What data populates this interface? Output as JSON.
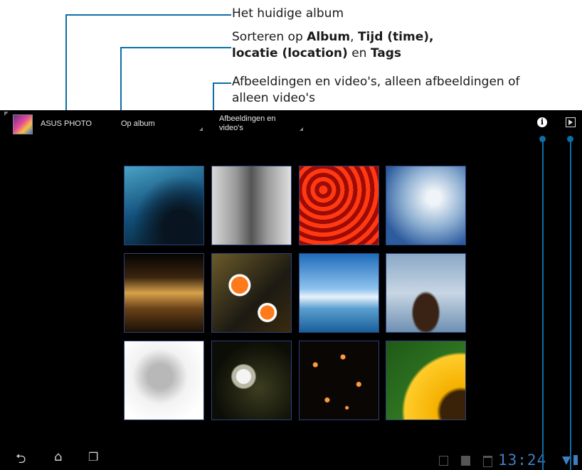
{
  "callouts": {
    "current_album": "Het huidige album",
    "sort_prefix": "Sorteren op ",
    "sort_album": "Album",
    "sort_comma1": ", ",
    "sort_time": "Tijd (time),",
    "sort_location": "locatie (location)",
    "sort_en": " en ",
    "sort_tags": "Tags",
    "filter_line1": "Afbeeldingen en video's, alleen afbeeldingen of",
    "filter_line2": "alleen video's"
  },
  "topbar": {
    "app_title": "ASUS PHOTO",
    "sort_selected": "Op album",
    "filter_selected_line1": "Afbeeldingen en",
    "filter_selected_line2": "video's",
    "info_icon": "info-icon",
    "slideshow_icon": "play-icon"
  },
  "gallery": {
    "items": [
      {
        "subject": "water-boat",
        "colors": [
          "#0e2a3f",
          "#2f7fa5"
        ]
      },
      {
        "subject": "couple-walking",
        "colors": [
          "#c8c8c8",
          "#4a4a4a"
        ]
      },
      {
        "subject": "red-lanterns",
        "colors": [
          "#c0140e",
          "#ff5a1f"
        ]
      },
      {
        "subject": "sky-clouds",
        "colors": [
          "#2f5fa8",
          "#d8e6f3"
        ]
      },
      {
        "subject": "building-night",
        "colors": [
          "#120c06",
          "#d79a3a"
        ]
      },
      {
        "subject": "clownfish",
        "colors": [
          "#1e1a12",
          "#e86a1a"
        ]
      },
      {
        "subject": "harbor-boat",
        "colors": [
          "#2a7fc8",
          "#dbeaf7"
        ]
      },
      {
        "subject": "rock-water",
        "colors": [
          "#6a8db0",
          "#5a3b26"
        ]
      },
      {
        "subject": "kitten",
        "colors": [
          "#f2f2f2",
          "#8a8a8a"
        ]
      },
      {
        "subject": "flower-dark",
        "colors": [
          "#0b0d06",
          "#e0e0e0"
        ]
      },
      {
        "subject": "sky-lanterns",
        "colors": [
          "#0a0604",
          "#ff8a2a"
        ]
      },
      {
        "subject": "sunflower",
        "colors": [
          "#f7b200",
          "#2e6b1e"
        ]
      }
    ]
  },
  "navbar": {
    "back_icon": "back-icon",
    "home_icon": "home-icon",
    "recent_icon": "recent-apps-icon",
    "clock": "13:24"
  },
  "colors": {
    "callout_line": "#0c6ea7",
    "clock": "#3f7fc2"
  }
}
